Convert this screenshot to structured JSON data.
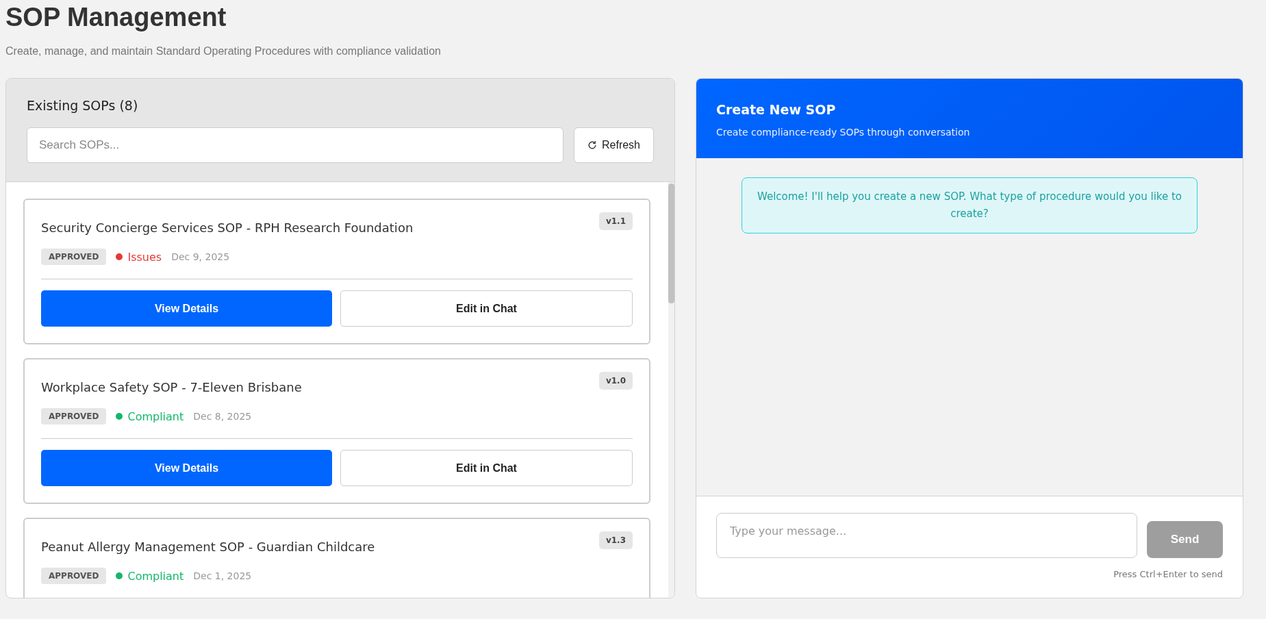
{
  "page": {
    "title": "SOP Management",
    "subtitle": "Create, manage, and maintain Standard Operating Procedures with compliance validation"
  },
  "sop_list": {
    "heading": "Existing SOPs (8)",
    "search": {
      "placeholder": "Search SOPs..."
    },
    "refresh_button": "Refresh",
    "items": [
      {
        "title": "Security Concierge Services SOP - RPH Research Foundation",
        "version": "v1.1",
        "status_badge": "APPROVED",
        "compliance": {
          "label": "Issues",
          "color": "#e53935"
        },
        "date": "Dec 9, 2025",
        "buttons": [
          "View Details",
          "Edit in Chat"
        ]
      },
      {
        "title": "Workplace Safety SOP - 7-Eleven Brisbane",
        "version": "v1.0",
        "status_badge": "APPROVED",
        "compliance": {
          "label": "Compliant",
          "color": "#12b76a"
        },
        "date": "Dec 8, 2025",
        "buttons": [
          "View Details",
          "Edit in Chat"
        ]
      },
      {
        "title": "Peanut Allergy Management SOP - Guardian Childcare",
        "version": "v1.3",
        "status_badge": "APPROVED",
        "compliance": {
          "label": "Compliant",
          "color": "#12b76a"
        },
        "date": "Dec 1, 2025"
      }
    ]
  },
  "chat": {
    "title": "Create New SOP",
    "subtitle": "Create compliance-ready SOPs through conversation",
    "messages": [
      {
        "kind": "assistant",
        "text": "Welcome! I'll help you create a new SOP. What type of procedure would you like to create?"
      }
    ],
    "input": {
      "placeholder": "Type your message..."
    },
    "send_button": {
      "label": "Send",
      "disabled": true
    },
    "hint": "Press Ctrl+Enter to send"
  }
}
